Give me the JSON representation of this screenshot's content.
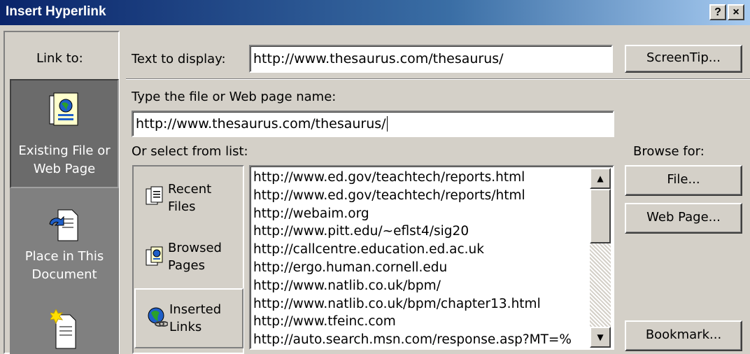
{
  "window": {
    "title": "Insert Hyperlink",
    "help_label": "?",
    "close_label": "×"
  },
  "sidebar": {
    "heading": "Link to:",
    "items": [
      {
        "line1": "Existing File or",
        "line2": "Web Page",
        "icon": "web-page-icon",
        "selected": true
      },
      {
        "line1": "Place in This",
        "line2": "Document",
        "icon": "place-in-document-icon",
        "selected": false
      },
      {
        "line1": "",
        "line2": "",
        "icon": "new-document-icon",
        "selected": false
      }
    ]
  },
  "form": {
    "text_to_display_label": "Text to display:",
    "text_to_display_value": "http://www.thesaurus.com/thesaurus/",
    "screentip_label": "ScreenTip...",
    "address_label": "Type the file or Web page name:",
    "address_value": "http://www.thesaurus.com/thesaurus/",
    "select_label": "Or select from list:",
    "browse_label": "Browse for:"
  },
  "list_tabs": [
    {
      "line1": "Recent",
      "line2": "Files",
      "icon": "recent-files-icon",
      "selected": false
    },
    {
      "line1": "Browsed",
      "line2": "Pages",
      "icon": "browsed-pages-icon",
      "selected": false
    },
    {
      "line1": "Inserted",
      "line2": "Links",
      "icon": "inserted-links-icon",
      "selected": true
    }
  ],
  "list_items": [
    "http://www.ed.gov/teachtech/reports.html",
    "http://www.ed.gov/teachtech/reports/html",
    "http://webaim.org",
    "http://www.pitt.edu/~eflst4/sig20",
    "http://callcentre.education.ed.ac.uk",
    "http://ergo.human.cornell.edu",
    "http://www.natlib.co.uk/bpm/",
    "http://www.natlib.co.uk/bpm/chapter13.html",
    "http://www.tfeinc.com",
    "http://auto.search.msn.com/response.asp?MT=%"
  ],
  "buttons": {
    "file": "File...",
    "web_page": "Web Page...",
    "bookmark": "Bookmark..."
  },
  "colors": {
    "title_start": "#0a246a",
    "title_end": "#a6caf0",
    "face": "#d4d0c8",
    "sidebar": "#808080"
  }
}
